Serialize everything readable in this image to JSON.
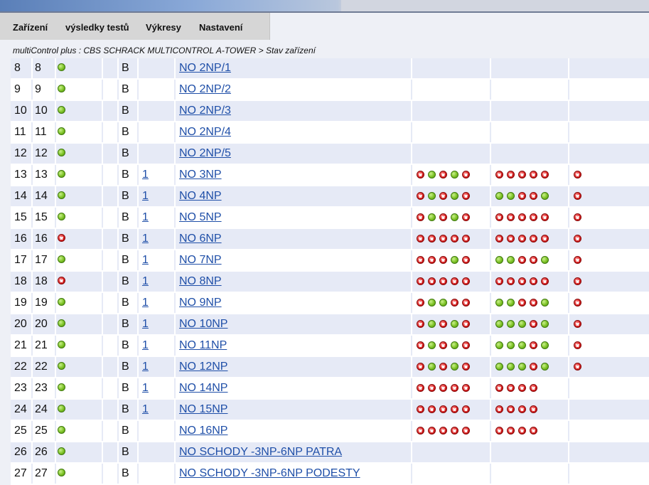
{
  "menu": [
    "Zařízení",
    "výsledky testů",
    "Výkresy",
    "Nastavení"
  ],
  "breadcrumb": "multiControl plus : CBS SCHRACK MULTICONTROL A-TOWER > Stav zařízení",
  "status_colors": {
    "ok": "#7cc225",
    "error": "#d61c1c"
  },
  "rows": [
    {
      "n1": "8",
      "n2": "8",
      "status": "ok",
      "type": "B",
      "link": "",
      "name": "NO 2NP/1",
      "g1": [],
      "g2": [],
      "g3": []
    },
    {
      "n1": "9",
      "n2": "9",
      "status": "ok",
      "type": "B",
      "link": "",
      "name": "NO 2NP/2",
      "g1": [],
      "g2": [],
      "g3": []
    },
    {
      "n1": "10",
      "n2": "10",
      "status": "ok",
      "type": "B",
      "link": "",
      "name": "NO 2NP/3",
      "g1": [],
      "g2": [],
      "g3": []
    },
    {
      "n1": "11",
      "n2": "11",
      "status": "ok",
      "type": "B",
      "link": "",
      "name": "NO 2NP/4",
      "g1": [],
      "g2": [],
      "g3": []
    },
    {
      "n1": "12",
      "n2": "12",
      "status": "ok",
      "type": "B",
      "link": "",
      "name": "NO 2NP/5",
      "g1": [],
      "g2": [],
      "g3": []
    },
    {
      "n1": "13",
      "n2": "13",
      "status": "ok",
      "type": "B",
      "link": "1",
      "name": "NO 3NP",
      "g1": [
        "err",
        "ok",
        "err",
        "ok",
        "err"
      ],
      "g2": [
        "err",
        "err",
        "err",
        "err",
        "err"
      ],
      "g3": [
        "err"
      ]
    },
    {
      "n1": "14",
      "n2": "14",
      "status": "ok",
      "type": "B",
      "link": "1",
      "name": "NO 4NP",
      "g1": [
        "err",
        "ok",
        "err",
        "ok",
        "err"
      ],
      "g2": [
        "ok",
        "ok",
        "err",
        "err",
        "ok"
      ],
      "g3": [
        "err"
      ]
    },
    {
      "n1": "15",
      "n2": "15",
      "status": "ok",
      "type": "B",
      "link": "1",
      "name": "NO 5NP",
      "g1": [
        "err",
        "ok",
        "err",
        "ok",
        "err"
      ],
      "g2": [
        "err",
        "err",
        "err",
        "err",
        "err"
      ],
      "g3": [
        "err"
      ]
    },
    {
      "n1": "16",
      "n2": "16",
      "status": "err",
      "type": "B",
      "link": "1",
      "name": "NO 6NP",
      "g1": [
        "err",
        "err",
        "err",
        "err",
        "err"
      ],
      "g2": [
        "err",
        "err",
        "err",
        "err",
        "err"
      ],
      "g3": [
        "err"
      ]
    },
    {
      "n1": "17",
      "n2": "17",
      "status": "ok",
      "type": "B",
      "link": "1",
      "name": "NO 7NP",
      "g1": [
        "err",
        "err",
        "err",
        "ok",
        "err"
      ],
      "g2": [
        "ok",
        "ok",
        "err",
        "err",
        "ok"
      ],
      "g3": [
        "err"
      ]
    },
    {
      "n1": "18",
      "n2": "18",
      "status": "err",
      "type": "B",
      "link": "1",
      "name": "NO 8NP",
      "g1": [
        "err",
        "err",
        "err",
        "err",
        "err"
      ],
      "g2": [
        "err",
        "err",
        "err",
        "err",
        "err"
      ],
      "g3": [
        "err"
      ]
    },
    {
      "n1": "19",
      "n2": "19",
      "status": "ok",
      "type": "B",
      "link": "1",
      "name": "NO 9NP",
      "g1": [
        "err",
        "ok",
        "ok",
        "err",
        "err"
      ],
      "g2": [
        "ok",
        "ok",
        "err",
        "err",
        "ok"
      ],
      "g3": [
        "err"
      ]
    },
    {
      "n1": "20",
      "n2": "20",
      "status": "ok",
      "type": "B",
      "link": "1",
      "name": "NO 10NP",
      "g1": [
        "err",
        "ok",
        "err",
        "ok",
        "err"
      ],
      "g2": [
        "ok",
        "ok",
        "ok",
        "err",
        "ok"
      ],
      "g3": [
        "err"
      ]
    },
    {
      "n1": "21",
      "n2": "21",
      "status": "ok",
      "type": "B",
      "link": "1",
      "name": "NO 11NP",
      "g1": [
        "err",
        "ok",
        "err",
        "ok",
        "err"
      ],
      "g2": [
        "ok",
        "ok",
        "ok",
        "err",
        "ok"
      ],
      "g3": [
        "err"
      ]
    },
    {
      "n1": "22",
      "n2": "22",
      "status": "ok",
      "type": "B",
      "link": "1",
      "name": "NO 12NP",
      "g1": [
        "err",
        "ok",
        "err",
        "ok",
        "err"
      ],
      "g2": [
        "ok",
        "ok",
        "ok",
        "err",
        "ok"
      ],
      "g3": [
        "err"
      ]
    },
    {
      "n1": "23",
      "n2": "23",
      "status": "ok",
      "type": "B",
      "link": "1",
      "name": "NO 14NP",
      "g1": [
        "err",
        "err",
        "err",
        "err",
        "err"
      ],
      "g2": [
        "err",
        "err",
        "err",
        "err"
      ],
      "g3": []
    },
    {
      "n1": "24",
      "n2": "24",
      "status": "ok",
      "type": "B",
      "link": "1",
      "name": "NO 15NP",
      "g1": [
        "err",
        "err",
        "err",
        "err",
        "err"
      ],
      "g2": [
        "err",
        "err",
        "err",
        "err"
      ],
      "g3": []
    },
    {
      "n1": "25",
      "n2": "25",
      "status": "ok",
      "type": "B",
      "link": "",
      "name": "NO 16NP",
      "g1": [
        "err",
        "err",
        "err",
        "err",
        "err"
      ],
      "g2": [
        "err",
        "err",
        "err",
        "err"
      ],
      "g3": []
    },
    {
      "n1": "26",
      "n2": "26",
      "status": "ok",
      "type": "B",
      "link": "",
      "name": "NO SCHODY -3NP-6NP PATRA",
      "g1": [],
      "g2": [],
      "g3": []
    },
    {
      "n1": "27",
      "n2": "27",
      "status": "ok",
      "type": "B",
      "link": "",
      "name": "NO SCHODY -3NP-6NP PODESTY",
      "g1": [],
      "g2": [],
      "g3": []
    }
  ]
}
